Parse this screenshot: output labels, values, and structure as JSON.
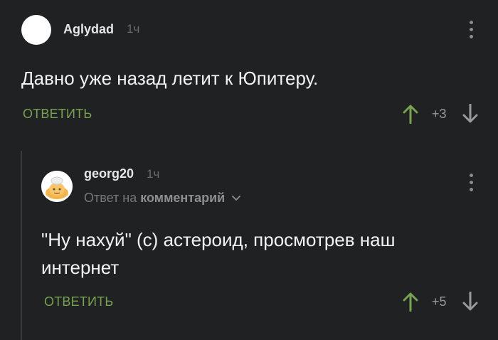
{
  "comment": {
    "username": "Aglydad",
    "time": "1ч",
    "text": "Давно уже назад летит к Юпитеру.",
    "reply_label": "ОТВЕТИТЬ",
    "score": "+3"
  },
  "reply": {
    "username": "georg20",
    "time": "1ч",
    "reply_to_prefix": "Ответ на",
    "reply_to_target": "комментарий",
    "text_line1": "\"Ну нахуй\" (с) астероид, просмотрев наш",
    "text_line2": "интернет",
    "reply_label": "ОТВЕТИТЬ",
    "score": "+5"
  },
  "colors": {
    "background": "#202123",
    "accent_green": "#77a24f",
    "muted_text": "#777777"
  },
  "icons": {
    "up": "arrow-up-icon",
    "down": "arrow-down-icon",
    "menu": "more-vertical-icon",
    "chevron": "chevron-down-icon"
  }
}
